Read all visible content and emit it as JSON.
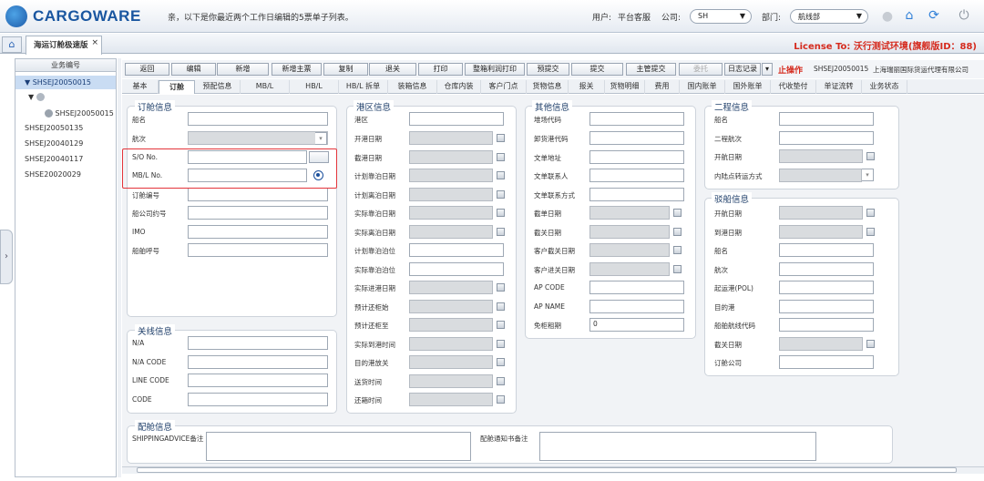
{
  "header": {
    "logo": "CARGOWARE",
    "welcome": "亲，以下是你最近两个工作日编辑的5票单子列表。",
    "user_label": "用户:",
    "user_value": "平台客服",
    "company_label": "公司:",
    "company_value": "SH",
    "dept_label": "部门:",
    "dept_value": "航线部"
  },
  "tabs": {
    "home": "⌂",
    "main": "海运订舱极速版",
    "close": "×",
    "license": "License To: 沃行测试环境(旗舰版ID：88)"
  },
  "left": {
    "header": "业务编号",
    "tree": [
      "SHSEJ20050015",
      "",
      "SHSEJ20050015",
      "SHSEJ20050135",
      "SHSEJ20040129",
      "SHSEJ20040117",
      "SHSE20020029"
    ]
  },
  "toolbar": {
    "buttons": [
      "返回",
      "编辑",
      "新增",
      "新增主票",
      "复制",
      "退关",
      "打印",
      "整箱利润打印",
      "预提交",
      "提交",
      "主管提交",
      "委托"
    ],
    "log": "日志记录",
    "stop": "止操作",
    "docno": "SHSEJ20050015",
    "company": "上海瑞丽国际货运代理有限公司"
  },
  "subtabs": [
    "基本",
    "订舱",
    "预配信息",
    "MB/L",
    "HB/L",
    "HB/L 拆单",
    "装箱信息",
    "仓库内装",
    "客户门点",
    "货物信息",
    "报关",
    "货物明细",
    "费用",
    "国内账单",
    "国外账单",
    "代收垫付",
    "单证流转",
    "业务状态"
  ],
  "booking": {
    "title": "订舱信息",
    "fields": [
      "船名",
      "航次",
      "S/O No.",
      "MB/L No.",
      "订舱编号",
      "船公司约号",
      "IMO",
      "船舶呼号"
    ]
  },
  "carrier": {
    "title": "关线信息",
    "fields": [
      "N/A",
      "N/A CODE",
      "LINE CODE",
      "CODE"
    ]
  },
  "port": {
    "title": "港区信息",
    "fields": [
      "港区",
      "开港日期",
      "截港日期",
      "计划靠泊日期",
      "计划离泊日期",
      "实际靠泊日期",
      "实际离泊日期",
      "计划靠泊泊位",
      "实际靠泊泊位",
      "实际进港日期",
      "预计还柜始",
      "预计还柜至",
      "实际到港时间",
      "目的港放关",
      "送货时间",
      "还箱时间"
    ]
  },
  "other": {
    "title": "其他信息",
    "fields": [
      "堆场代码",
      "卸货港代码",
      "文单地址",
      "文单联系人",
      "文单联系方式",
      "截单日期",
      "截关日期",
      "客户截关日期",
      "客户进关日期",
      "AP CODE",
      "AP NAME",
      "免柜租期"
    ],
    "free_days": "0"
  },
  "second": {
    "title": "二程信息",
    "fields": [
      "船名",
      "二程航次",
      "开航日期",
      "内陆点转运方式"
    ]
  },
  "vessel": {
    "title": "驳船信息",
    "fields": [
      "开航日期",
      "到港日期",
      "船名",
      "航次",
      "起运港(POL)",
      "目的港",
      "船舶航线代码",
      "截关日期",
      "订舱公司"
    ]
  },
  "stowage": {
    "title": "配舱信息",
    "remark1": "SHIPPINGADVICE备注",
    "remark2": "配舱通知书备注"
  }
}
